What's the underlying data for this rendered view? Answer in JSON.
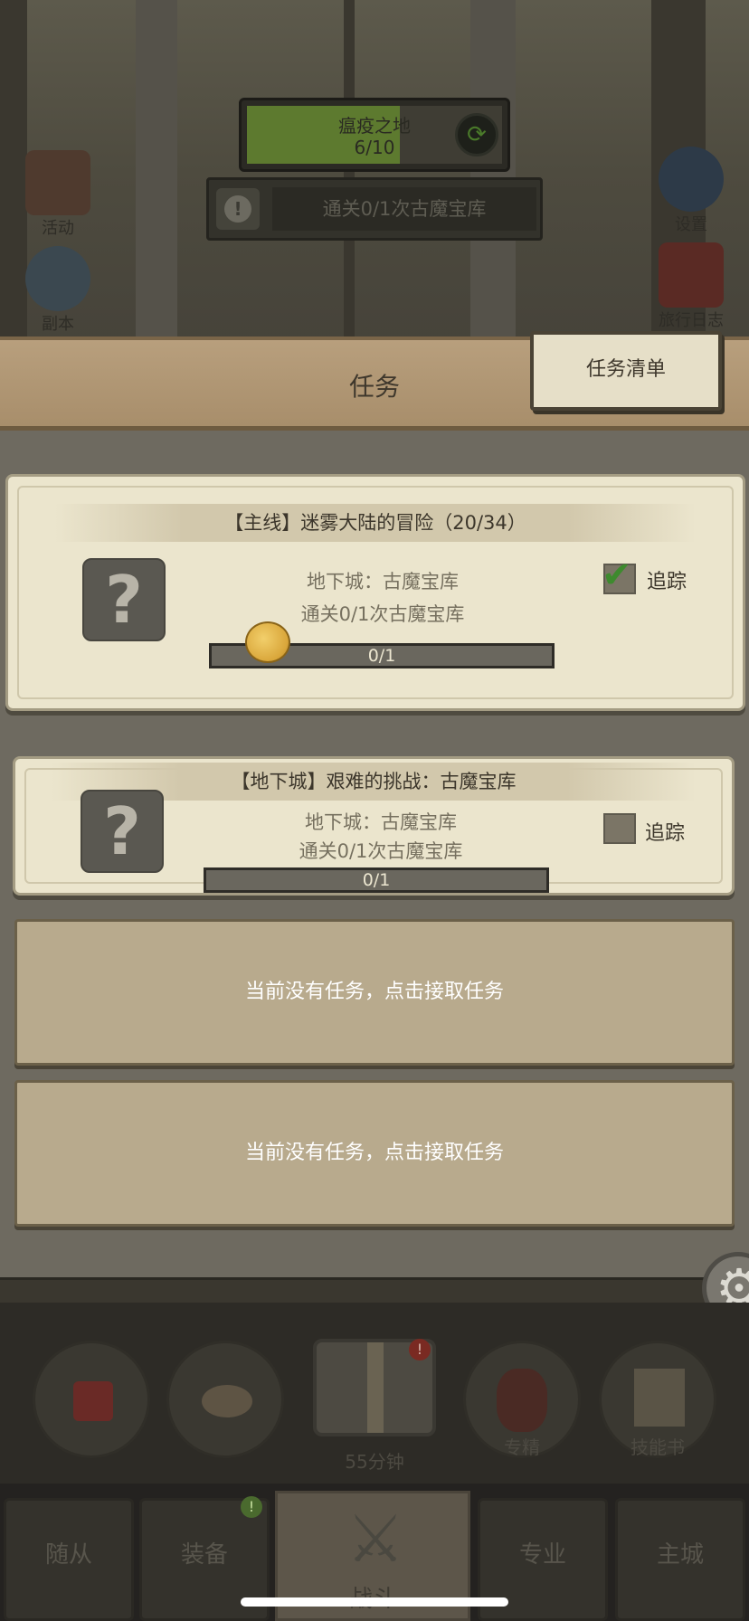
{
  "top": {
    "region_name": "瘟疫之地",
    "region_progress": "6/10",
    "region_progress_fraction": 0.6,
    "objective_text": "通关0/1次古魔宝库",
    "left_icons": [
      {
        "label": "活动",
        "icon": "event-icon"
      },
      {
        "label": "副本",
        "icon": "dungeon-icon"
      }
    ],
    "right_icons": [
      {
        "label": "设置",
        "icon": "gear-icon"
      },
      {
        "label": "旅行日志",
        "icon": "journal-icon"
      }
    ]
  },
  "panel": {
    "title": "任务",
    "tab_label": "任务清单"
  },
  "quests": [
    {
      "header": "【主线】迷雾大陆的冒险（20/34）",
      "line1": "地下城：古魔宝库",
      "line2": "通关0/1次古魔宝库",
      "progress": "0/1",
      "progress_fraction": 0,
      "track_label": "追踪",
      "tracked": true
    },
    {
      "header": "【地下城】艰难的挑战：古魔宝库",
      "line1": "地下城：古魔宝库",
      "line2": "通关0/1次古魔宝库",
      "progress": "0/1",
      "progress_fraction": 0,
      "track_label": "追踪",
      "tracked": false
    }
  ],
  "empty_slots": [
    {
      "text": "当前没有任务，点击接取任务"
    },
    {
      "text": "当前没有任务，点击接取任务"
    }
  ],
  "items": {
    "chest_timer": "55分钟",
    "specialization_label": "专精",
    "skillbook_label": "技能书",
    "chest_badge": "!"
  },
  "nav": {
    "followers": "随从",
    "equipment": "装备",
    "battle": "战斗",
    "profession": "专业",
    "main_city": "主城",
    "equipment_badge": "!"
  },
  "colors": {
    "parchment": "#ebe5cd",
    "panel_wood": "#b89f7d",
    "progress_green": "#5d7a2f",
    "track_check": "#3e8a2e"
  }
}
